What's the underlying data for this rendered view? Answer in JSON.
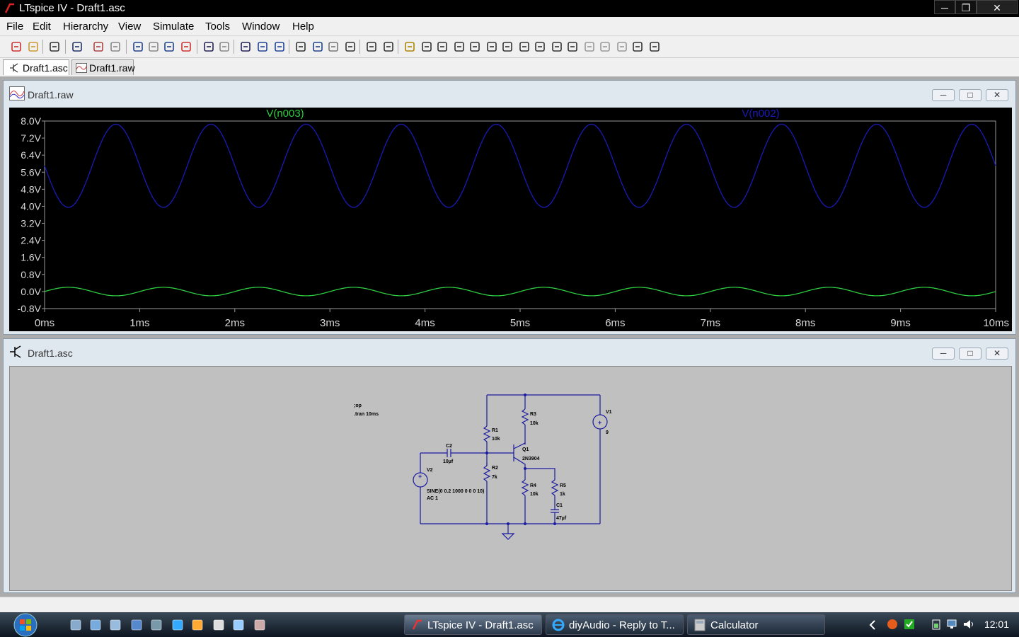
{
  "window": {
    "title": "LTspice IV - Draft1.asc"
  },
  "menu": [
    "File",
    "Edit",
    "Hierarchy",
    "View",
    "Simulate",
    "Tools",
    "Window",
    "Help"
  ],
  "toolbar_icons": [
    "new-schematic-icon",
    "open-icon",
    "save-icon",
    "control-panel-icon",
    "run-icon",
    "halt-icon",
    "zoom-in-icon",
    "zoom-area-icon",
    "zoom-out-icon",
    "zoom-cancel-icon",
    "tile-horizontal-icon",
    "tile-vertical-icon",
    "cascade-icon",
    "close-all-icon",
    "window-icon",
    "cut-icon",
    "copy-icon",
    "paste-icon",
    "find-icon",
    "print-preview-icon",
    "print-icon",
    "wire-icon",
    "ground-icon",
    "label-icon",
    "resistor-icon",
    "capacitor-icon",
    "inductor-icon",
    "diode-icon",
    "component-icon",
    "move-icon",
    "drag-icon",
    "undo-icon",
    "redo-icon",
    "rotate-icon",
    "mirror-icon",
    "text-icon",
    "spice-directive-icon"
  ],
  "tabs": [
    {
      "label": "Draft1.asc",
      "active": true
    },
    {
      "label": "Draft1.raw",
      "active": false
    }
  ],
  "waveform_window": {
    "title": "Draft1.raw"
  },
  "schematic_window": {
    "title": "Draft1.asc"
  },
  "chart_data": {
    "type": "line",
    "series": [
      {
        "name": "V(n003)",
        "color": "#2ecc40",
        "offset": 0.0,
        "amplitude": 0.2,
        "freq_hz": 1000,
        "phase": "sin"
      },
      {
        "name": "V(n002)",
        "color": "#1a1ab8",
        "offset": 5.9,
        "amplitude": 1.95,
        "freq_hz": 1000,
        "phase": "-sin"
      }
    ],
    "x_ticks": [
      "0ms",
      "1ms",
      "2ms",
      "3ms",
      "4ms",
      "5ms",
      "6ms",
      "7ms",
      "8ms",
      "9ms",
      "10ms"
    ],
    "y_ticks": [
      "8.0V",
      "7.2V",
      "6.4V",
      "5.6V",
      "4.8V",
      "4.0V",
      "3.2V",
      "2.4V",
      "1.6V",
      "0.8V",
      "0.0V",
      "-0.8V"
    ],
    "xlim": [
      0,
      10
    ],
    "ylim": [
      -0.8,
      8.0
    ]
  },
  "schematic": {
    "directives": [
      ";op",
      ".tran 10ms"
    ],
    "components": {
      "R1": {
        "name": "R1",
        "value": "10k"
      },
      "R2": {
        "name": "R2",
        "value": "7k"
      },
      "R3": {
        "name": "R3",
        "value": "10k"
      },
      "R4": {
        "name": "R4",
        "value": "10k"
      },
      "R5": {
        "name": "R5",
        "value": "1k"
      },
      "C1": {
        "name": "C1",
        "value": "47µf"
      },
      "C2": {
        "name": "C2",
        "value": "10µf"
      },
      "Q1": {
        "name": "Q1",
        "value": "2N3904"
      },
      "V1": {
        "name": "V1",
        "value": "9"
      },
      "V2": {
        "name": "V2",
        "value": "SINE(0 0.2 1000 0 0 0 10)",
        "value2": "AC 1"
      }
    }
  },
  "taskbar": {
    "tasks": [
      "LTspice IV - Draft1.asc",
      "diyAudio - Reply to T...",
      "Calculator"
    ],
    "clock": "12:01"
  }
}
